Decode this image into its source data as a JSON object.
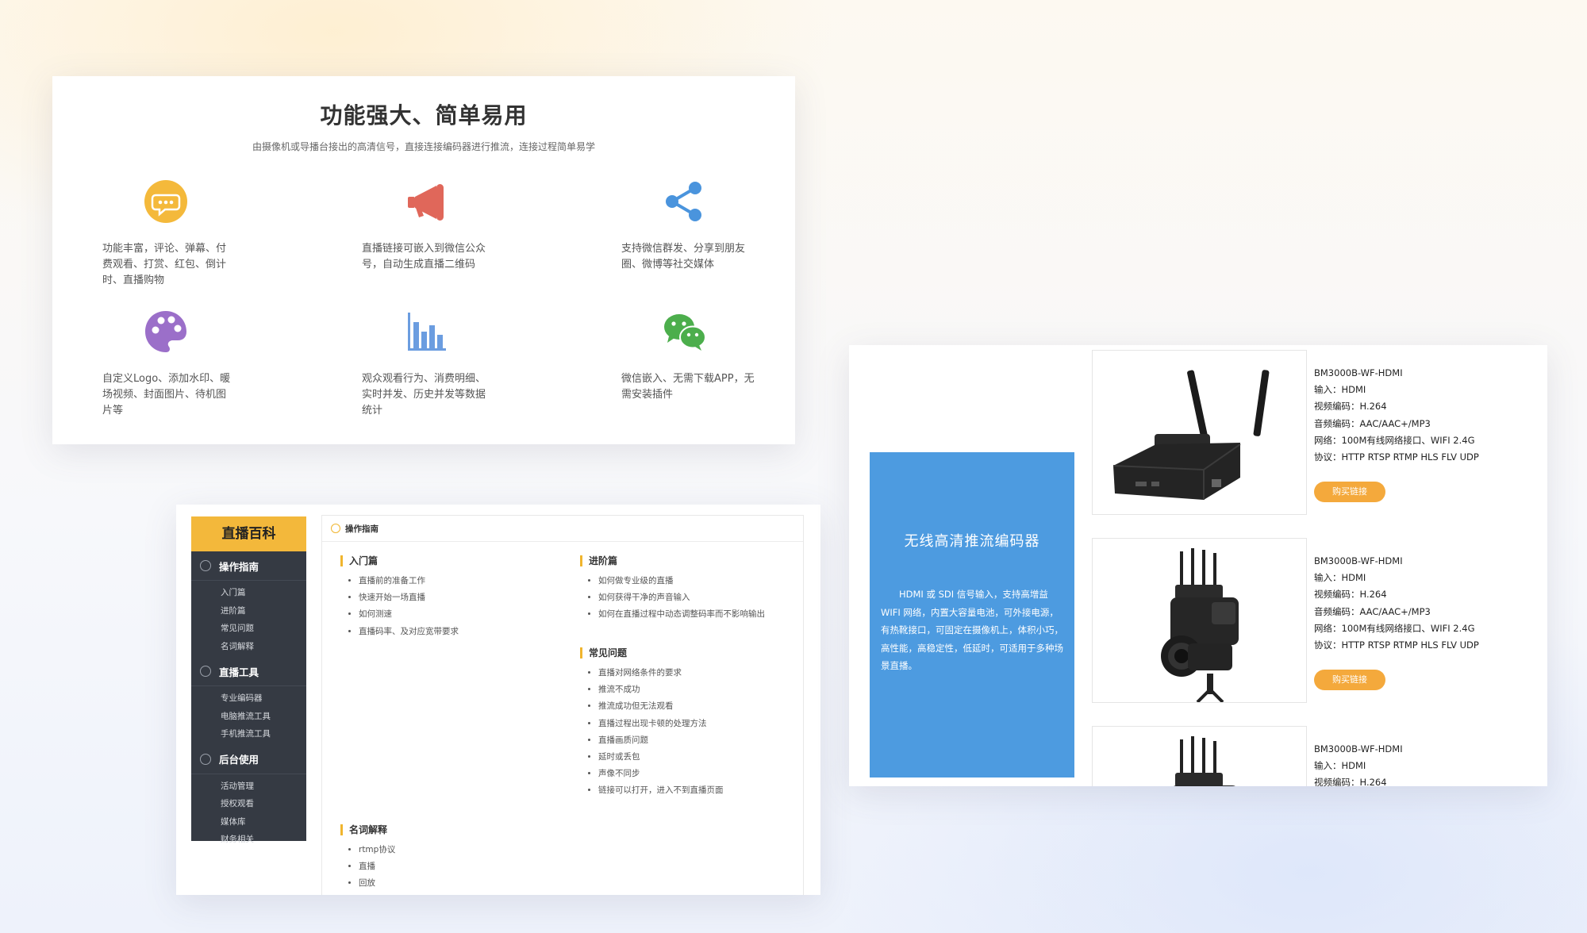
{
  "features": {
    "title": "功能强大、简单易用",
    "subtitle": "由摄像机或导播台接出的高清信号，直接连接编码器进行推流，连接过程简单易学",
    "items": [
      {
        "icon": "chat-bubble-icon",
        "color": "#f4b93b",
        "text": "功能丰富，评论、弹幕、付费观看、打赏、红包、倒计时、直播购物"
      },
      {
        "icon": "megaphone-icon",
        "color": "#e0675a",
        "text": "直播链接可嵌入到微信公众号，自动生成直播二维码"
      },
      {
        "icon": "share-icon",
        "color": "#4a94dd",
        "text": "支持微信群发、分享到朋友圈、微博等社交媒体"
      },
      {
        "icon": "palette-icon",
        "color": "#9b6fc9",
        "text": "自定义Logo、添加水印、暖场视频、封面图片、待机图片等"
      },
      {
        "icon": "bar-chart-icon",
        "color": "#6b9de0",
        "text": "观众观看行为、消费明细、实时并发、历史并发等数据统计"
      },
      {
        "icon": "wechat-icon",
        "color": "#4cae4c",
        "text": "微信嵌入、无需下载APP，无需安装插件"
      }
    ]
  },
  "wiki": {
    "sidebar_title": "直播百科",
    "sections": [
      {
        "label": "操作指南",
        "items": [
          "入门篇",
          "进阶篇",
          "常见问题",
          "名词解释"
        ]
      },
      {
        "label": "直播工具",
        "items": [
          "专业编码器",
          "电脑推流工具",
          "手机推流工具"
        ]
      },
      {
        "label": "后台使用",
        "items": [
          "活动管理",
          "授权观看",
          "媒体库",
          "财务相关"
        ]
      }
    ],
    "main_title": "操作指南",
    "groups": {
      "rumen": {
        "title": "入门篇",
        "items": [
          "直播前的准备工作",
          "快速开始一场直播",
          "如何测速",
          "直播码率、及对应宽带要求"
        ]
      },
      "jinjie": {
        "title": "进阶篇",
        "items": [
          "如何做专业级的直播",
          "如何获得干净的声音输入",
          "如何在直播过程中动态调整码率而不影响输出"
        ]
      },
      "changjian": {
        "title": "常见问题",
        "items": [
          "直播对网络条件的要求",
          "推流不成功",
          "推流成功但无法观看",
          "直播过程出现卡顿的处理方法",
          "直播画质问题",
          "延时或丢包",
          "声像不同步",
          "链接可以打开，进入不到直播页面"
        ]
      },
      "mingci": {
        "title": "名词解释",
        "items": [
          "rtmp协议",
          "直播",
          "回放"
        ]
      }
    }
  },
  "encoder": {
    "banner_title": "无线高清推流编码器",
    "banner_desc": "HDMI 或 SDI 信号输入，支持高增益WIFI 网络，内置大容量电池，可外接电源，有热靴接口，可固定在摄像机上，体积小巧，高性能，高稳定性，低延时，可适用于多种场景直播。",
    "products": [
      {
        "lines": [
          "BM3000B-WF-HDMI",
          "输入：HDMI",
          "视频编码：H.264",
          "音频编码：AAC/AAC+/MP3",
          "网络：100M有线网络接口、WIFI 2.4G",
          "协议：HTTP RTSP RTMP HLS FLV UDP"
        ],
        "buy_label": "购买链接"
      },
      {
        "lines": [
          "BM3000B-WF-HDMI",
          "输入：HDMI",
          "视频编码：H.264",
          "音频编码：AAC/AAC+/MP3",
          "网络：100M有线网络接口、WIFI 2.4G",
          "协议：HTTP RTSP RTMP HLS FLV UDP"
        ],
        "buy_label": "购买链接"
      },
      {
        "lines": [
          "BM3000B-WF-HDMI",
          "输入：HDMI",
          "视频编码：H.264"
        ],
        "buy_label": ""
      }
    ]
  }
}
